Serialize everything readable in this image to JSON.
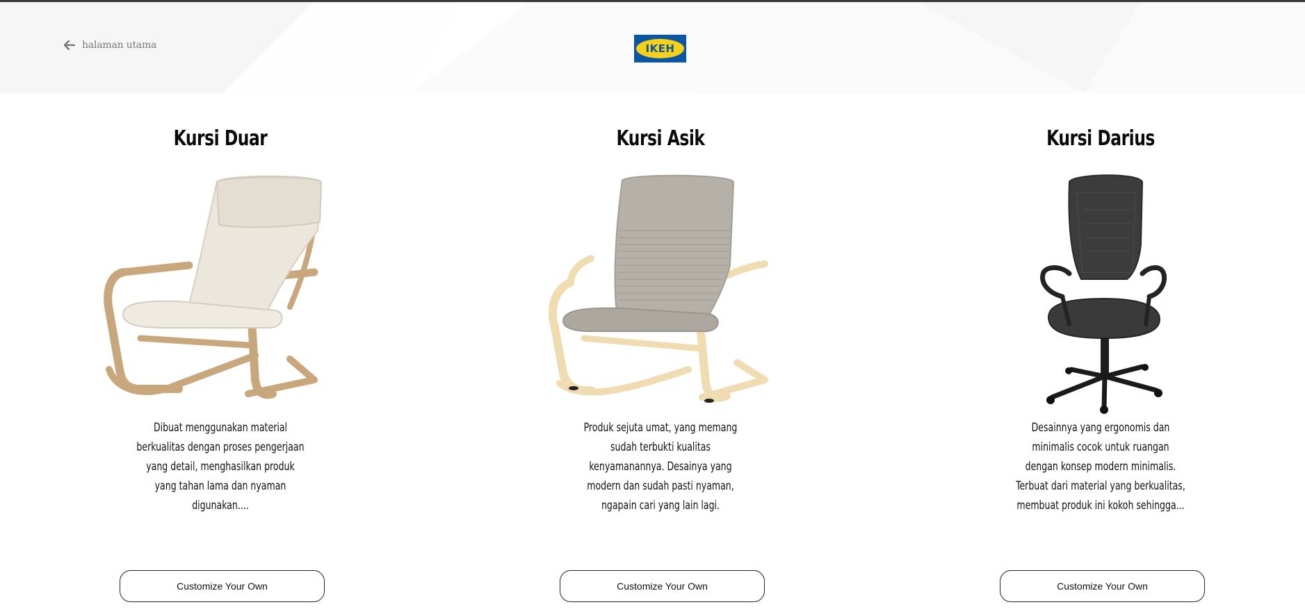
{
  "header": {
    "back_label": "halaman utama",
    "logo_text": "IKEH",
    "colors": {
      "logo_blue": "#0a56a5",
      "logo_yellow": "#f7d117",
      "header_bg": "#f7f6f6"
    }
  },
  "products": [
    {
      "title": "Kursi Duar",
      "description": "Dibuat menggunakan material berkualitas dengan proses pengerjaan yang detail, menghasilkan produk yang tahan lama dan nyaman digunakan....",
      "button_label": "Customize Your Own",
      "image_icon": "armchair-beige-icon"
    },
    {
      "title": "Kursi Asik",
      "description": "Produk sejuta umat, yang memang sudah terbukti kualitas kenyamanannya. Desainya yang modern dan sudah pasti nyaman, ngapain cari yang lain lagi.",
      "button_label": "Customize Your Own",
      "image_icon": "armchair-grey-icon"
    },
    {
      "title": "Kursi Darius",
      "description": "Desainnya yang ergonomis dan minimalis cocok untuk ruangan dengan konsep modern minimalis. Terbuat dari material yang berkualitas, membuat produk ini kokoh sehingga...",
      "button_label": "Customize Your Own",
      "image_icon": "office-chair-black-icon"
    }
  ]
}
